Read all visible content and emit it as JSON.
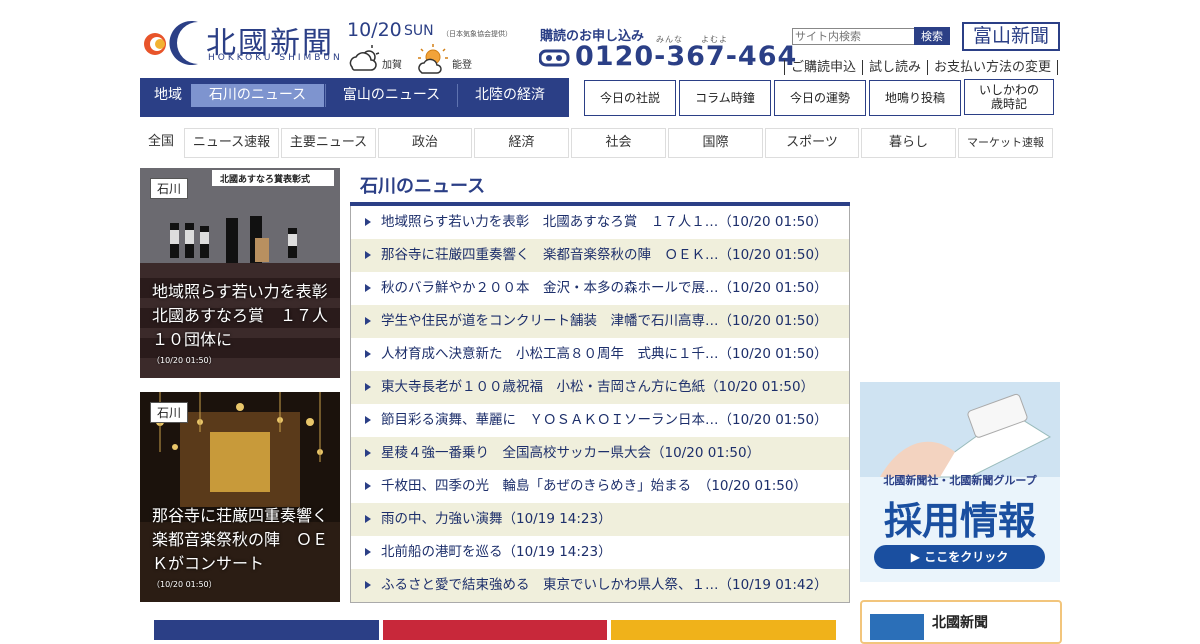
{
  "header": {
    "logo_title": "北國新聞",
    "logo_sub": "HOKKOKU SHIMBUN",
    "date": "10/20",
    "day": "SUN",
    "weather_note": "（日本気象協会提供）",
    "weather": [
      {
        "area": "加賀",
        "icon": "cloud-sun-icon"
      },
      {
        "area": "能登",
        "icon": "sun-cloud-icon"
      }
    ],
    "subscribe_label": "購読のお申し込み",
    "phone_ruby": "みんな　　よむよ",
    "phone": "0120-367-464",
    "search_placeholder": "サイト内検索",
    "search_button": "検索",
    "toyama_button": "富山新聞",
    "top_links": [
      "ご購読申込",
      "試し読み",
      "お支払い方法の変更"
    ]
  },
  "region_nav": {
    "label": "地域",
    "items": [
      "石川のニュース",
      "富山のニュース",
      "北陸の経済"
    ]
  },
  "box_buttons": [
    "今日の社説",
    "コラム時鐘",
    "今日の運勢",
    "地鳴り投稿",
    "いしかわの",
    "歳時記"
  ],
  "category_nav": [
    "全国",
    "ニュース速報",
    "主要ニュース",
    "政治",
    "経済",
    "社会",
    "国際",
    "スポーツ",
    "暮らし",
    "マーケット速報"
  ],
  "photos": [
    {
      "tag": "石川",
      "title": "地域照らす若い力を表彰　北國あすなろ賞　１７人１０団体に",
      "time": "（10/20 01:50）",
      "banner": "北國あすなろ賞表彰式"
    },
    {
      "tag": "石川",
      "title": "那谷寺に荘厳四重奏響く　楽都音楽祭秋の陣　ＯＥＫがコンサート",
      "time": "（10/20 01:50）"
    }
  ],
  "news": {
    "section_title": "石川のニュース",
    "items": [
      "地域照らす若い力を表彰　北國あすなろ賞　１７人１…（10/20 01:50）",
      "那谷寺に荘厳四重奏響く　楽都音楽祭秋の陣　ＯＥＫ…（10/20 01:50）",
      "秋のバラ鮮やか２００本　金沢・本多の森ホールで展…（10/20 01:50）",
      "学生や住民が道をコンクリート舗装　津幡で石川高専…（10/20 01:50）",
      "人材育成へ決意新た　小松工高８０周年　式典に１千…（10/20 01:50）",
      "東大寺長老が１００歳祝福　小松・吉岡さん方に色紙（10/20 01:50）",
      "節目彩る演舞、華麗に　ＹＯＳＡＫＯＩソーラン日本…（10/20 01:50）",
      "星稜４強一番乗り　全国高校サッカー県大会（10/20 01:50）",
      "千枚田、四季の光　輪島「あぜのきらめき」始まる　（10/20 01:50）",
      "雨の中、力強い演舞（10/19 14:23）",
      "北前船の港町を巡る（10/19 14:23）",
      "ふるさと愛で結束強める　東京でいしかわ県人祭、１…（10/19 01:42）"
    ]
  },
  "ad": {
    "company": "北國新聞社・北國新聞グループ",
    "headline": "採用情報",
    "button": "▶ ここをクリック"
  },
  "ad2": {
    "title": "北國新聞"
  },
  "colors": {
    "brand": "#2b3f86",
    "active": "#7e94cf",
    "alt_row": "#f0efdc"
  }
}
